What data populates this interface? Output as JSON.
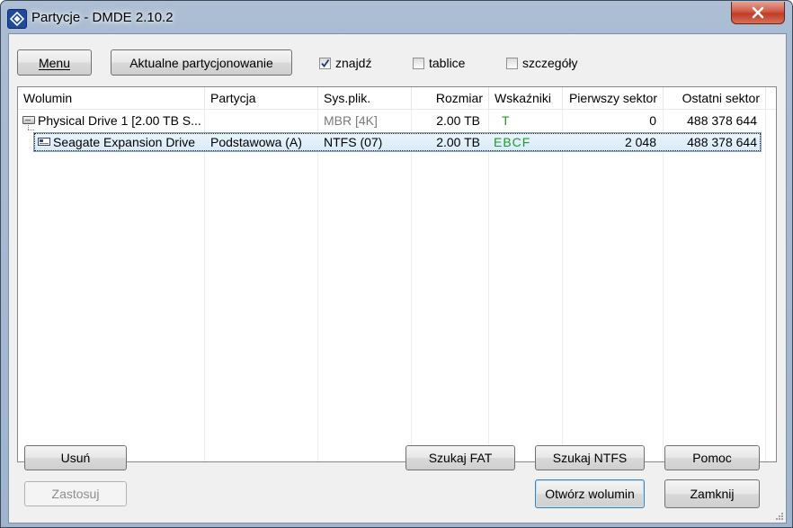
{
  "window": {
    "title": "Partycje - DMDE 2.10.2"
  },
  "toolbar": {
    "menu_label": "Menu",
    "current_partitioning_label": "Aktualne partycjonowanie",
    "checkboxes": [
      {
        "label": "znajdź",
        "checked": true
      },
      {
        "label": "tablice",
        "checked": false
      },
      {
        "label": "szczegóły",
        "checked": false
      }
    ]
  },
  "table": {
    "columns": [
      "Wolumin",
      "Partycja",
      "Sys.plik.",
      "Rozmiar",
      "Wskaźniki",
      "Pierwszy sektor",
      "Ostatni sektor"
    ],
    "rows": [
      {
        "volume": "Physical Drive 1 [2.00 TB S...",
        "partition": "",
        "filesystem": "MBR [4K]",
        "size": "2.00 TB",
        "flags": "T",
        "first_sector": "0",
        "last_sector": "488 378 644",
        "icon": "drive-icon"
      },
      {
        "volume": "Seagate Expansion Drive",
        "partition": "Podstawowa (A)",
        "filesystem": "NTFS (07)",
        "size": "2.00 TB",
        "flags": "EBCF",
        "first_sector": "2 048",
        "last_sector": "488 378 644",
        "icon": "volume-icon",
        "selected": true
      }
    ]
  },
  "buttons": {
    "delete": "Usuń",
    "apply": "Zastosuj",
    "search_fat": "Szukaj FAT",
    "search_ntfs": "Szukaj NTFS",
    "help": "Pomoc",
    "open_volume": "Otwórz wolumin",
    "close": "Zamknij"
  },
  "colors": {
    "flags_green": "#1d9c2a",
    "close_button_red": "#c03c25",
    "selection_border": "#7da2ce"
  }
}
